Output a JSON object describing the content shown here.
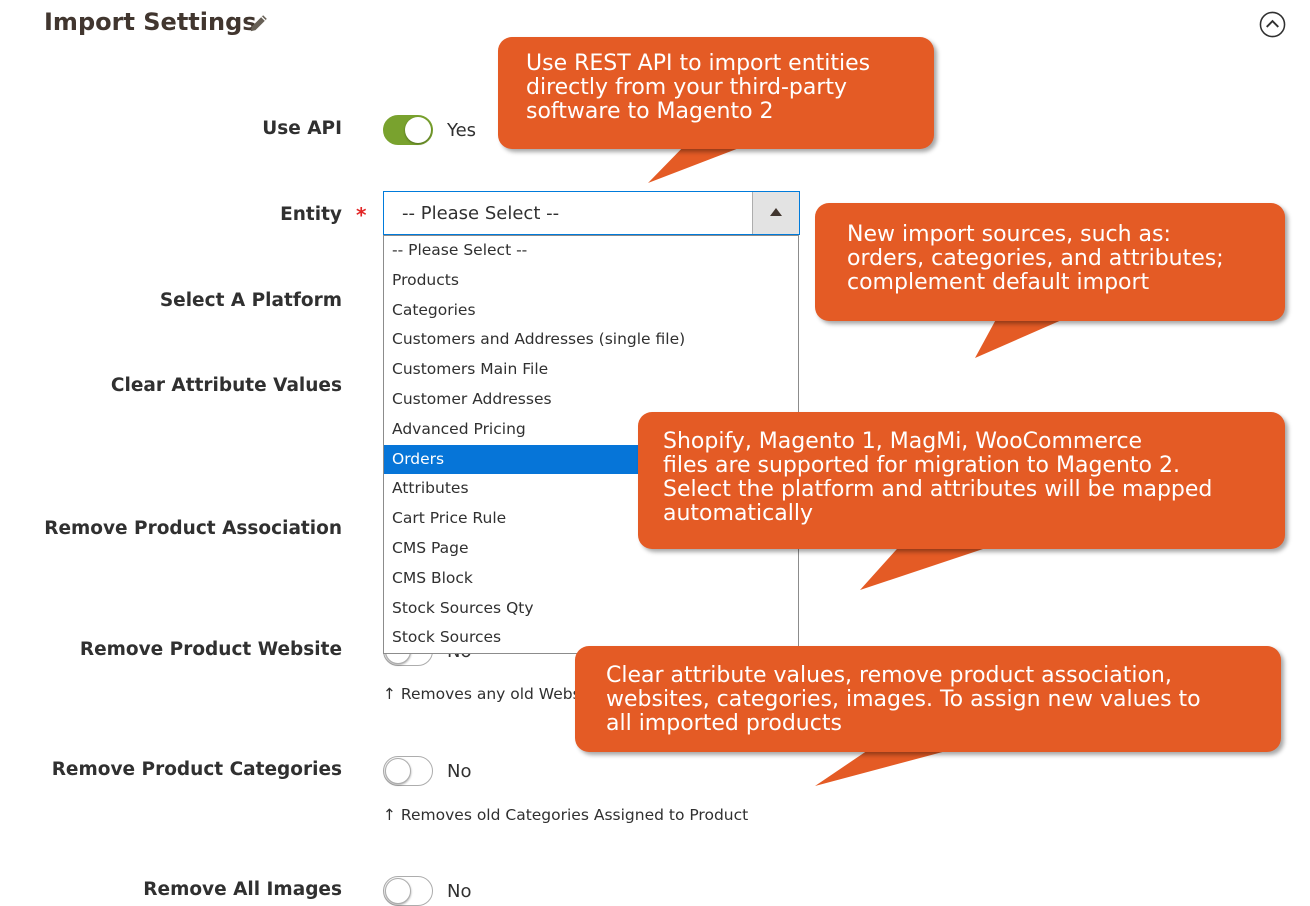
{
  "header": {
    "title": "Import Settings"
  },
  "fields": {
    "use_api": {
      "label": "Use API",
      "state": "Yes"
    },
    "entity": {
      "label": "Entity",
      "required_mark": "*",
      "value": "-- Please Select --",
      "options": [
        "-- Please Select --",
        "Products",
        "Categories",
        "Customers and Addresses (single file)",
        "Customers Main File",
        "Customer Addresses",
        "Advanced Pricing",
        "Orders",
        "Attributes",
        "Cart Price Rule",
        "CMS Page",
        "CMS Block",
        "Stock Sources Qty",
        "Stock Sources"
      ],
      "highlighted_option": "Orders"
    },
    "select_platform": {
      "label": "Select A Platform"
    },
    "clear_attribute_values": {
      "label": "Clear Attribute Values"
    },
    "remove_product_association": {
      "label": "Remove Product Association"
    },
    "remove_product_website": {
      "label": "Remove Product Website",
      "state": "No",
      "note": "↑ Removes any old Websi"
    },
    "remove_product_categories": {
      "label": "Remove Product Categories",
      "state": "No",
      "note": "↑ Removes old Categories Assigned to Product"
    },
    "remove_all_images": {
      "label": "Remove All Images",
      "state": "No"
    }
  },
  "callouts": {
    "rest_api": "Use REST API to import entities\ndirectly from your third-party\nsoftware to Magento 2",
    "new_sources": "New import sources, such as:\norders, categories, and attributes;\ncomplement default import",
    "platforms": "Shopify, Magento 1, MagMi, WooCommerce\nfiles are supported for migration to Magento 2.\nSelect the platform and attributes will be mapped\nautomatically",
    "clear_values": "Clear attribute values, remove product association,\nwebsites, categories, images. To assign new values to\nall imported products"
  },
  "colors": {
    "callout": "#e45b25",
    "toggle_on": "#79a22e",
    "selected_option": "#0675d8",
    "required": "#e22626",
    "focus_border": "#007bdb"
  },
  "icons": [
    "pencil-icon",
    "chevron-up-circle-icon",
    "caret-up-icon",
    "arrow-up-icon"
  ]
}
